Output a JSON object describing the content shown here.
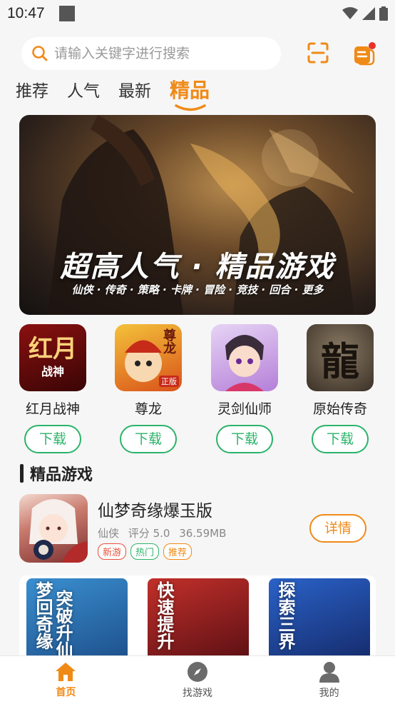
{
  "status_bar": {
    "time": "10:47"
  },
  "search": {
    "placeholder": "请输入关键字进行搜索"
  },
  "tabs": [
    {
      "label": "推荐",
      "active": false
    },
    {
      "label": "人气",
      "active": false
    },
    {
      "label": "最新",
      "active": false
    },
    {
      "label": "精品",
      "active": true
    }
  ],
  "banner": {
    "title": "超高人气 · 精品游戏",
    "subtitle": "仙侠 · 传奇 · 策略 · 卡牌 · 冒险 · 竞技 · 回合 · 更多"
  },
  "games": [
    {
      "name": "红月战神",
      "icon_text": "红月",
      "icon_subtext": "战神",
      "download_label": "下载"
    },
    {
      "name": "尊龙",
      "icon_text": "尊龙",
      "icon_subtext": "正版",
      "download_label": "下载"
    },
    {
      "name": "灵剑仙师",
      "icon_text": "",
      "icon_subtext": "",
      "download_label": "下载"
    },
    {
      "name": "原始传奇",
      "icon_text": "龍",
      "icon_subtext": "",
      "download_label": "下载"
    }
  ],
  "section": {
    "title": "精品游戏"
  },
  "featured_game": {
    "name": "仙梦奇缘爆玉版",
    "category": "仙侠",
    "rating": "评分 5.0",
    "size": "36.59MB",
    "tags": [
      {
        "label": "新游",
        "color": "#e8503a"
      },
      {
        "label": "热门",
        "color": "#2bb36a"
      },
      {
        "label": "推荐",
        "color": "#f08a17"
      }
    ],
    "detail_label": "详情"
  },
  "cards": [
    {
      "text_a": "梦回奇缘",
      "text_b": "突破升仙"
    },
    {
      "text_a": "快速提升",
      "text_b": ""
    },
    {
      "text_a": "探索三界",
      "text_b": ""
    }
  ],
  "bottom_nav": [
    {
      "label": "首页",
      "icon": "home-icon",
      "active": true
    },
    {
      "label": "找游戏",
      "icon": "compass-icon",
      "active": false
    },
    {
      "label": "我的",
      "icon": "user-icon",
      "active": false
    }
  ],
  "colors": {
    "accent": "#f08a17",
    "download": "#2bb36a"
  }
}
